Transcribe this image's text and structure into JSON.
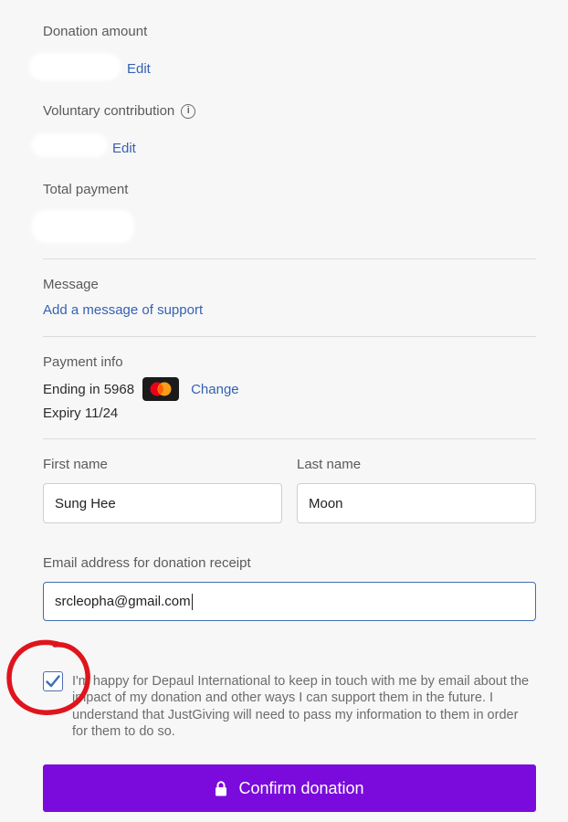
{
  "donation": {
    "amount_label": "Donation amount",
    "amount_edit": "Edit",
    "voluntary_label": "Voluntary contribution",
    "voluntary_edit": "Edit",
    "total_label": "Total payment"
  },
  "message": {
    "label": "Message",
    "add_link": "Add a message of support"
  },
  "payment": {
    "label": "Payment info",
    "ending": "Ending in 5968",
    "change_link": "Change",
    "expiry": "Expiry 11/24",
    "card_icon": "mastercard-icon"
  },
  "form": {
    "first_name_label": "First name",
    "first_name_value": "Sung Hee",
    "last_name_label": "Last name",
    "last_name_value": "Moon",
    "email_label": "Email address for donation receipt",
    "email_value": "srcleopha@gmail.com"
  },
  "consent": {
    "checked": true,
    "text": "I'm happy for Depaul International to keep in touch with me by email about the impact of my donation and other ways I can support them in the future. I understand that JustGiving will need to pass my information to them in order for them to do so."
  },
  "confirm": {
    "label": "Confirm donation",
    "icon": "lock-icon",
    "color": "#7a0bdc"
  },
  "annotation": {
    "circle_color": "#e0141c"
  }
}
